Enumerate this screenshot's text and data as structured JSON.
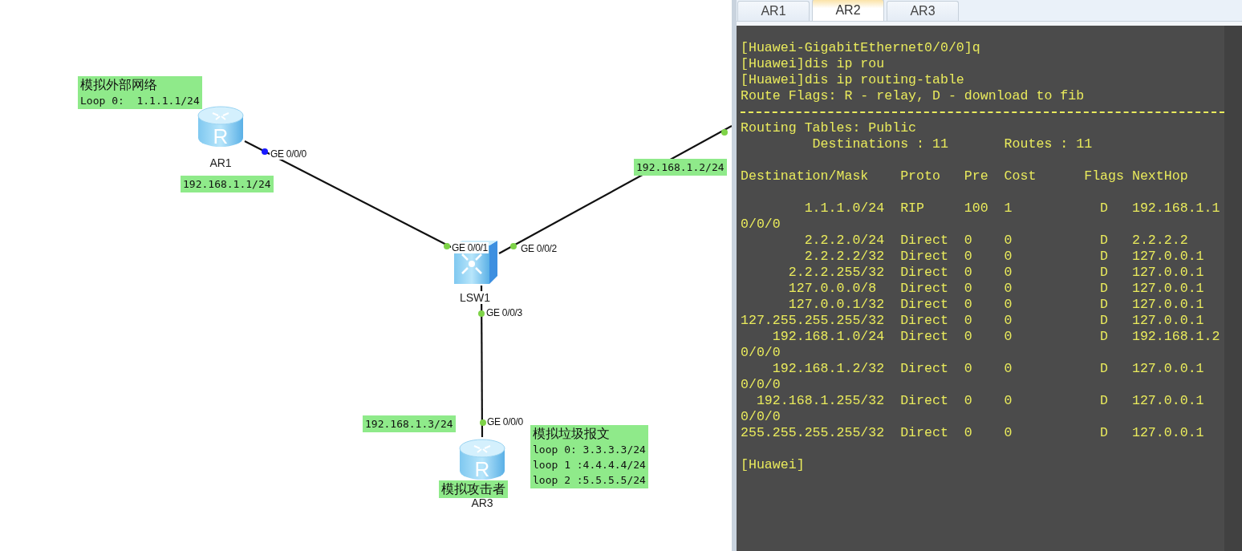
{
  "topology": {
    "devices": [
      {
        "kind": "router",
        "name": "AR1",
        "glyph": "R"
      },
      {
        "kind": "switch",
        "name": "LSW1"
      },
      {
        "kind": "router",
        "name": "AR3",
        "glyph": "R"
      }
    ],
    "ports": [
      {
        "label": "GE 0/0/0",
        "color": "#1a1aff"
      },
      {
        "label": "GE 0/0/1",
        "color": "#7ed348"
      },
      {
        "label": "GE 0/0/2",
        "color": "#7ed348"
      },
      {
        "label": "GE 0/0/3",
        "color": "#7ed348"
      },
      {
        "label": "GE 0/0/0",
        "color": "#7ed348"
      },
      {
        "color": "#7ed348"
      }
    ],
    "notes": [
      {
        "kind": "titled",
        "lines": [
          "模拟外部网络",
          "Loop 0:  1.1.1.1/24"
        ]
      },
      {
        "kind": "plain",
        "lines": [
          "192.168.1.1/24"
        ]
      },
      {
        "kind": "plain",
        "lines": [
          "192.168.1.2/24"
        ]
      },
      {
        "kind": "plain",
        "lines": [
          "192.168.1.3/24"
        ]
      },
      {
        "kind": "title",
        "lines": [
          "模拟攻击者"
        ]
      },
      {
        "kind": "titled",
        "lines": [
          "模拟垃圾报文",
          "loop 0: 3.3.3.3/24",
          "loop 1 :4.4.4.4/24",
          "loop 2 :5.5.5.5/24"
        ]
      }
    ]
  },
  "console": {
    "tabs": [
      {
        "label": "AR1",
        "selected": false
      },
      {
        "label": "AR2",
        "selected": true
      },
      {
        "label": "AR3",
        "selected": false
      }
    ],
    "lines": [
      {
        "kind": "text",
        "text": "[Huawei-GigabitEthernet0/0/0]q"
      },
      {
        "kind": "text",
        "text": "[Huawei]dis ip rou"
      },
      {
        "kind": "text",
        "text": "[Huawei]dis ip routing-table"
      },
      {
        "kind": "text",
        "text": "Route Flags: R - relay, D - download to fib"
      },
      {
        "kind": "rule"
      },
      {
        "kind": "text",
        "text": "Routing Tables: Public"
      },
      {
        "kind": "text",
        "text": "         Destinations : 11       Routes : 11"
      },
      {
        "kind": "blank"
      },
      {
        "kind": "text",
        "text": "Destination/Mask    Proto   Pre  Cost      Flags NextHop"
      },
      {
        "kind": "blank"
      },
      {
        "kind": "text",
        "text": "        1.1.1.0/24  RIP     100  1           D   192.168.1.1"
      },
      {
        "kind": "text",
        "text": "0/0/0"
      },
      {
        "kind": "text",
        "text": "        2.2.2.0/24  Direct  0    0           D   2.2.2.2"
      },
      {
        "kind": "text",
        "text": "        2.2.2.2/32  Direct  0    0           D   127.0.0.1"
      },
      {
        "kind": "text",
        "text": "      2.2.2.255/32  Direct  0    0           D   127.0.0.1"
      },
      {
        "kind": "text",
        "text": "      127.0.0.0/8   Direct  0    0           D   127.0.0.1"
      },
      {
        "kind": "text",
        "text": "      127.0.0.1/32  Direct  0    0           D   127.0.0.1"
      },
      {
        "kind": "text",
        "text": "127.255.255.255/32  Direct  0    0           D   127.0.0.1"
      },
      {
        "kind": "text",
        "text": "    192.168.1.0/24  Direct  0    0           D   192.168.1.2"
      },
      {
        "kind": "text",
        "text": "0/0/0"
      },
      {
        "kind": "text",
        "text": "    192.168.1.2/32  Direct  0    0           D   127.0.0.1"
      },
      {
        "kind": "text",
        "text": "0/0/0"
      },
      {
        "kind": "text",
        "text": "  192.168.1.255/32  Direct  0    0           D   127.0.0.1"
      },
      {
        "kind": "text",
        "text": "0/0/0"
      },
      {
        "kind": "text",
        "text": "255.255.255.255/32  Direct  0    0           D   127.0.0.1"
      },
      {
        "kind": "blank"
      },
      {
        "kind": "text",
        "text": "[Huawei]"
      }
    ]
  }
}
